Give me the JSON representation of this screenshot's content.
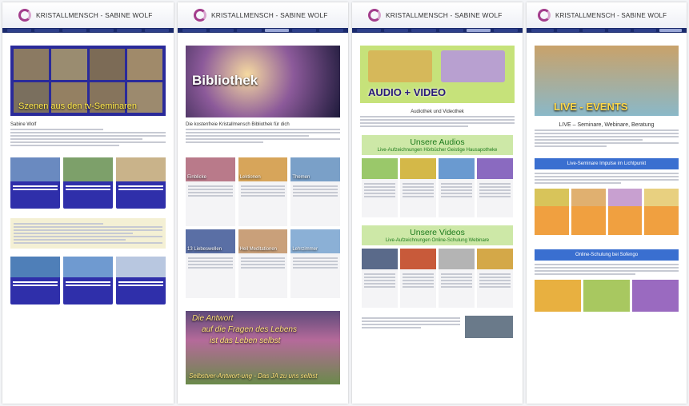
{
  "pages": [
    {
      "brand": "KRISTALLMENSCH - SABINE WOLF",
      "banner_text": "Szenen aus den tv-Seminaren",
      "name": "Sabine Wolf"
    },
    {
      "brand": "KRISTALLMENSCH - SABINE WOLF",
      "banner_text": "Bibliothek",
      "heading": "Die kostenfreie Kristallmensch Bibliothek für dich",
      "tiles": [
        "Einblicke",
        "Lektionen",
        "Themen",
        "13 Liebeswellen",
        "Heil Meditationen",
        "Lehrzimmer"
      ],
      "promo_title": "Die Antwort",
      "promo_line1": "auf die Fragen des Lebens",
      "promo_line2": "ist das Leben selbst",
      "promo_bottom": "Selbstver-Antwort-ung - Das JA zu uns selbst"
    },
    {
      "brand": "KRISTALLMENSCH - SABINE WOLF",
      "banner_text": "AUDIO + VIDEO",
      "heading": "Audiothek und Videothek",
      "audio_title": "Unsere Audios",
      "audio_sub": "Live-Aufzeichnungen   Hörbücher   Geistige Hausapotheke",
      "video_title": "Unsere Videos",
      "video_sub": "Live-Aufzeichnungen   Online-Schulung   Webinare"
    },
    {
      "brand": "KRISTALLMENSCH - SABINE WOLF",
      "banner_text": "LIVE - EVENTS",
      "heading": "LIVE – Seminare, Webinare, Beratung",
      "band1": "Live-Seminare Impulse im Lichtpunkt",
      "band2": "Online-Schulung bei Sofengo"
    }
  ],
  "colors": {
    "nav": "#1a2a6c",
    "accent": "#a33d8c",
    "green": "#1c7a1c",
    "blue": "#2f2faa",
    "band": "#3a6fd0"
  }
}
